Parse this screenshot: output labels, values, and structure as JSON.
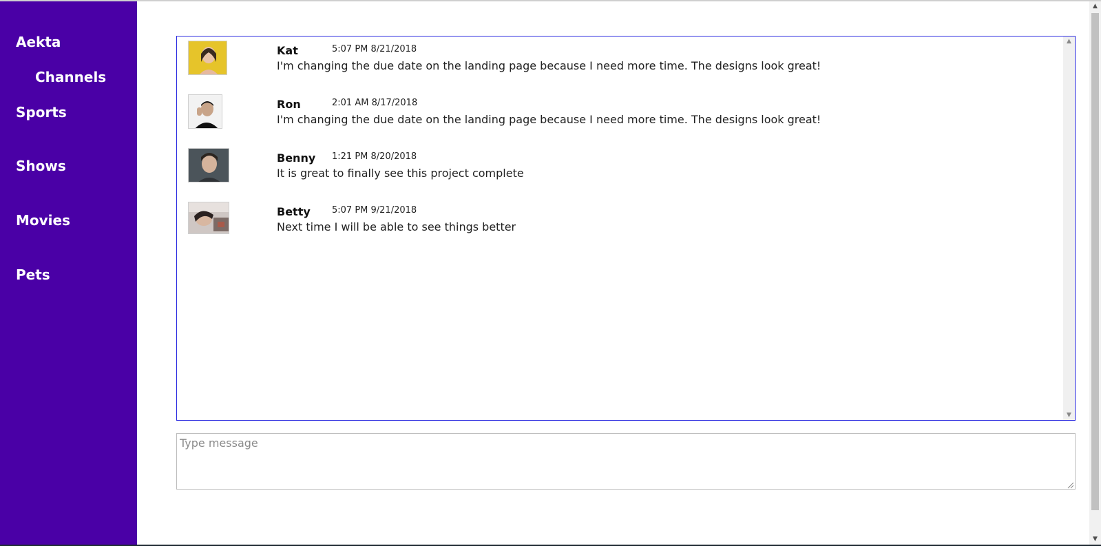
{
  "sidebar": {
    "brand": "Aekta",
    "channels_heading": "Channels",
    "items": [
      {
        "label": "Sports"
      },
      {
        "label": "Shows"
      },
      {
        "label": "Movies"
      },
      {
        "label": "Pets"
      }
    ],
    "background_color": "#4a00a6"
  },
  "messages": [
    {
      "author": "Kat",
      "time": "5:07 PM 8/21/2018",
      "text": "I'm changing the due date on the landing page because I need more time. The designs look great!"
    },
    {
      "author": "Ron",
      "time": "2:01 AM 8/17/2018",
      "text": "I'm changing the due date on the landing page because I need more time. The designs look great!"
    },
    {
      "author": "Benny",
      "time": "1:21 PM 8/20/2018",
      "text": "It is great to finally see this project complete"
    },
    {
      "author": "Betty",
      "time": "5:07 PM 9/21/2018",
      "text": "Next time I will be able to see things better"
    }
  ],
  "composer": {
    "placeholder": "Type message",
    "value": ""
  },
  "colors": {
    "sidebar": "#4a00a6",
    "message_box_border": "#2a2ae0"
  }
}
